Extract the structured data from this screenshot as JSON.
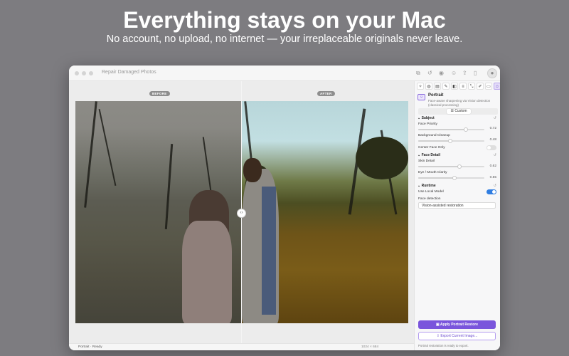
{
  "hero": {
    "title": "Everything stays on your Mac",
    "subtitle": "No account, no upload, no internet — your irreplaceable originals never leave."
  },
  "window": {
    "title": "Repair Damaged Photos",
    "toolbar_icons": [
      "copy-icon",
      "undo-icon",
      "eye-icon",
      "face-icon",
      "share-icon",
      "sidebar-icon",
      "profile-icon"
    ]
  },
  "canvas": {
    "before_label": "BEFORE",
    "after_label": "AFTER",
    "split_handle_glyph": "‹›"
  },
  "status": {
    "left": "Portrait · Ready",
    "right": "1024 × 684"
  },
  "panel": {
    "mode_title": "Portrait",
    "mode_desc": "Face-aware sharpening via Vision detection (classical processing)",
    "preset_label": "Custom",
    "sections": {
      "subject": "Subject",
      "face_detail": "Face Detail",
      "runtime": "Runtime"
    },
    "controls": {
      "face_priority": {
        "label": "Face Priority",
        "value": "0.72",
        "level": 0.72
      },
      "background_cleanup": {
        "label": "Background Cleanup",
        "value": "0.48",
        "level": 0.48
      },
      "center_face_only": {
        "label": "Center Face Only",
        "on": false
      },
      "skin_detail": {
        "label": "Skin Detail",
        "value": "0.62",
        "level": 0.62
      },
      "eye_mouth_clarity": {
        "label": "Eye / Mouth Clarity",
        "value": "0.55",
        "level": 0.55
      },
      "use_local_model": {
        "label": "Use Local Model",
        "on": true
      },
      "face_detection": {
        "label": "Face detection",
        "value": "Vision-assisted restoration"
      }
    },
    "apply_button": "Apply Portrait Restore",
    "export_button": "Export Current Image...",
    "footer": "Portrait restoration is ready to export."
  },
  "colors": {
    "accent": "#7a55dc",
    "toggle_on": "#2f7de1",
    "background": "#7d7c80"
  }
}
